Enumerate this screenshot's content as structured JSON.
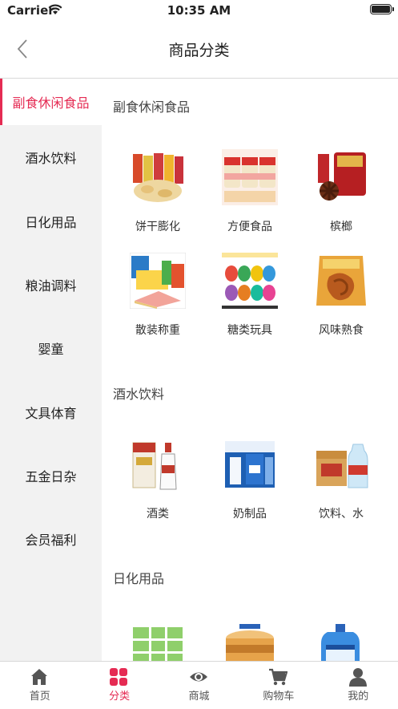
{
  "status": {
    "carrier": "Carrier",
    "time": "10:35 AM"
  },
  "nav": {
    "title": "商品分类"
  },
  "sidebar": {
    "items": [
      {
        "label": "副食休闲食品",
        "active": true
      },
      {
        "label": "酒水饮料"
      },
      {
        "label": "日化用品"
      },
      {
        "label": "粮油调料"
      },
      {
        "label": "婴童"
      },
      {
        "label": "文具体育"
      },
      {
        "label": "五金日杂"
      },
      {
        "label": "会员福利"
      }
    ]
  },
  "sections": [
    {
      "title": "副食休闲食品",
      "items": [
        {
          "label": "饼干膨化",
          "icon": "snack-bags-image"
        },
        {
          "label": "方便食品",
          "icon": "instant-noodle-cups-image"
        },
        {
          "label": "槟榔",
          "icon": "betel-nut-image"
        },
        {
          "label": "散装称重",
          "icon": "bulk-cakes-image"
        },
        {
          "label": "糖类玩具",
          "icon": "candy-eggs-image"
        },
        {
          "label": "风味熟食",
          "icon": "cooked-food-image"
        }
      ]
    },
    {
      "title": "酒水饮料",
      "items": [
        {
          "label": "酒类",
          "icon": "liquor-image"
        },
        {
          "label": "奶制品",
          "icon": "dairy-image"
        },
        {
          "label": "饮料、水",
          "icon": "water-drinks-image"
        }
      ]
    },
    {
      "title": "日化用品",
      "items": [
        {
          "label": "",
          "icon": "tissue-image"
        },
        {
          "label": "",
          "icon": "tin-product-image"
        },
        {
          "label": "",
          "icon": "detergent-image"
        }
      ]
    }
  ],
  "tabs": [
    {
      "label": "首页",
      "icon": "home-icon"
    },
    {
      "label": "分类",
      "icon": "category-icon",
      "active": true
    },
    {
      "label": "商城",
      "icon": "eye-icon"
    },
    {
      "label": "购物车",
      "icon": "cart-icon"
    },
    {
      "label": "我的",
      "icon": "user-icon"
    }
  ],
  "colors": {
    "accent": "#e52b53",
    "sidebar_bg": "#f2f2f2",
    "icon_gray": "#555555"
  }
}
